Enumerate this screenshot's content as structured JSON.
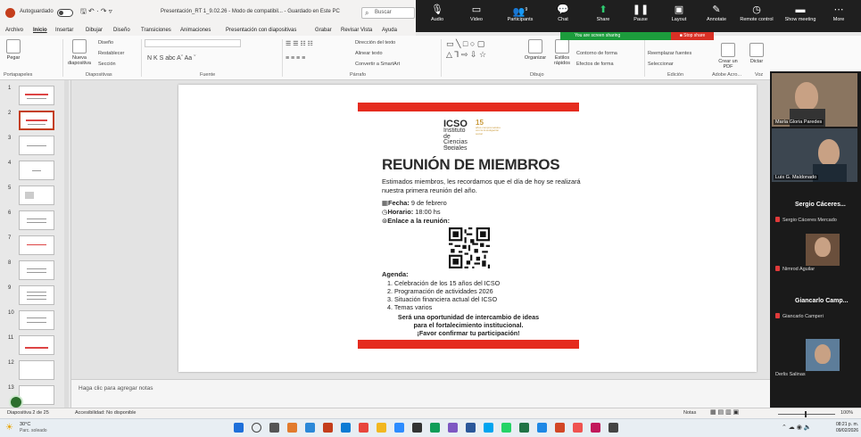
{
  "titlebar": {
    "autosave_label": "Autoguardado",
    "file_title": "Presentación_RT 1_9.02.26 - Modo de compatibil... - Guardado en Este PC",
    "search_placeholder": "Buscar",
    "symbols": "🖫 ↶ · ↷ ▿"
  },
  "menu": [
    "Archivo",
    "Inicio",
    "Insertar",
    "Dibujar",
    "Diseño",
    "Transiciones",
    "Animaciones",
    "Presentación con diapositivas",
    "Grabar",
    "Revisar",
    "Vista",
    "Ayuda"
  ],
  "zoom": {
    "buttons": [
      {
        "icon": "🎙",
        "label": "Audio"
      },
      {
        "icon": "▭",
        "label": "Video"
      },
      {
        "icon": "👥",
        "label": "Participants"
      },
      {
        "icon": "💬",
        "label": "Chat"
      },
      {
        "icon": "⬆",
        "label": "Share"
      },
      {
        "icon": "❚❚",
        "label": "Pause"
      },
      {
        "icon": "▣",
        "label": "Layout"
      },
      {
        "icon": "✎",
        "label": "Annotate"
      },
      {
        "icon": "◷",
        "label": "Remote control"
      },
      {
        "icon": "▬",
        "label": "Show meeting"
      },
      {
        "icon": "⋯",
        "label": "More"
      }
    ],
    "sharing_banner": "You are screen sharing",
    "stop_share": "■ Stop share",
    "participant_count": "9"
  },
  "ribbon": {
    "groups": [
      "Portapapeles",
      "Diapositivas",
      "Fuente",
      "Párrafo",
      "Dibujo",
      "Edición",
      "Adobe Acro...",
      "Voz",
      "Complementos"
    ],
    "buttons": {
      "paste": "Pegar",
      "new_slide": "Nueva diapositiva",
      "layout": "Diseño",
      "reset": "Restablecer",
      "section": "Sección",
      "text_direction": "Dirección del texto",
      "align_text": "Alinear texto",
      "smartart": "Convertir a SmartArt",
      "organize": "Organizar",
      "quick_styles": "Estilos rápidos",
      "shape_fill": "Relleno de forma",
      "shape_outline": "Contorno de forma",
      "shape_effects": "Efectos de forma",
      "find": "Buscar y reemplazar",
      "replace_fonts": "Reemplazar fuentes",
      "select": "Seleccionar",
      "create_pdf": "Crear un PDF",
      "dictate": "Dictar",
      "addins": "Complementos",
      "designer": "Diseñador"
    }
  },
  "slide": {
    "logo_icso": "ICSO",
    "logo_institute": "Instituto de Ciencias Sociales",
    "logo_15": "15",
    "logo_15_sub": "años comprometidos con la investigación social",
    "logo_place": "Paraguay",
    "title": "REUNIÓN DE MIEMBROS",
    "intro": "Estimados miembros, les recordamos que el día de hoy se realizará nuestra primera reunión del año.",
    "date_label": "Fecha:",
    "date_value": " 9 de febrero",
    "time_label": "Horario:",
    "time_value": " 18:00 hs",
    "link_label": "Enlace a la reunión:",
    "agenda_title": "Agenda:",
    "agenda": [
      "1. Celebración de los 15 años del ICSO",
      "2. Programación de actividades 2026",
      "3. Situación financiera actual del ICSO",
      "4. Temas varios"
    ],
    "closing": [
      "Será una oportunidad de intercambio de ideas",
      "para el fortalecimiento institucional.",
      "¡Favor confirmar tu participación!"
    ]
  },
  "notes_placeholder": "Haga clic para agregar notas",
  "thumbnails": [
    "1",
    "2",
    "3",
    "4",
    "5",
    "6",
    "7",
    "8",
    "9",
    "10",
    "11",
    "12",
    "13"
  ],
  "participants": {
    "video1": "María Gloria Paredes",
    "video2": "Luis G. Maldonado",
    "tiles": [
      {
        "big": "Sergio Cáceres...",
        "small": "Sergio Cáceres Mercado"
      },
      {
        "big": "",
        "small": "Nimrod Aguilar"
      },
      {
        "big": "Giancarlo Camp...",
        "small": "Giancarlo Camperi"
      },
      {
        "big": "",
        "small": "Derlis Salinas"
      }
    ]
  },
  "status": {
    "slide_of": "Diapositiva 2 de 25",
    "accessibility": "Accesibilidad: No disponible",
    "notes": "Notas",
    "zoom": "100%"
  },
  "taskbar": {
    "temp": "30°C",
    "weather": "Parc. soleado",
    "time": "08:21 p. m.",
    "date": "09/02/2026"
  },
  "colors": {
    "accent_red": "#e52b1e",
    "ppt_orange": "#c43e1c",
    "zoom_green": "#1c9c3c",
    "logo_gold": "#c99a3b"
  }
}
